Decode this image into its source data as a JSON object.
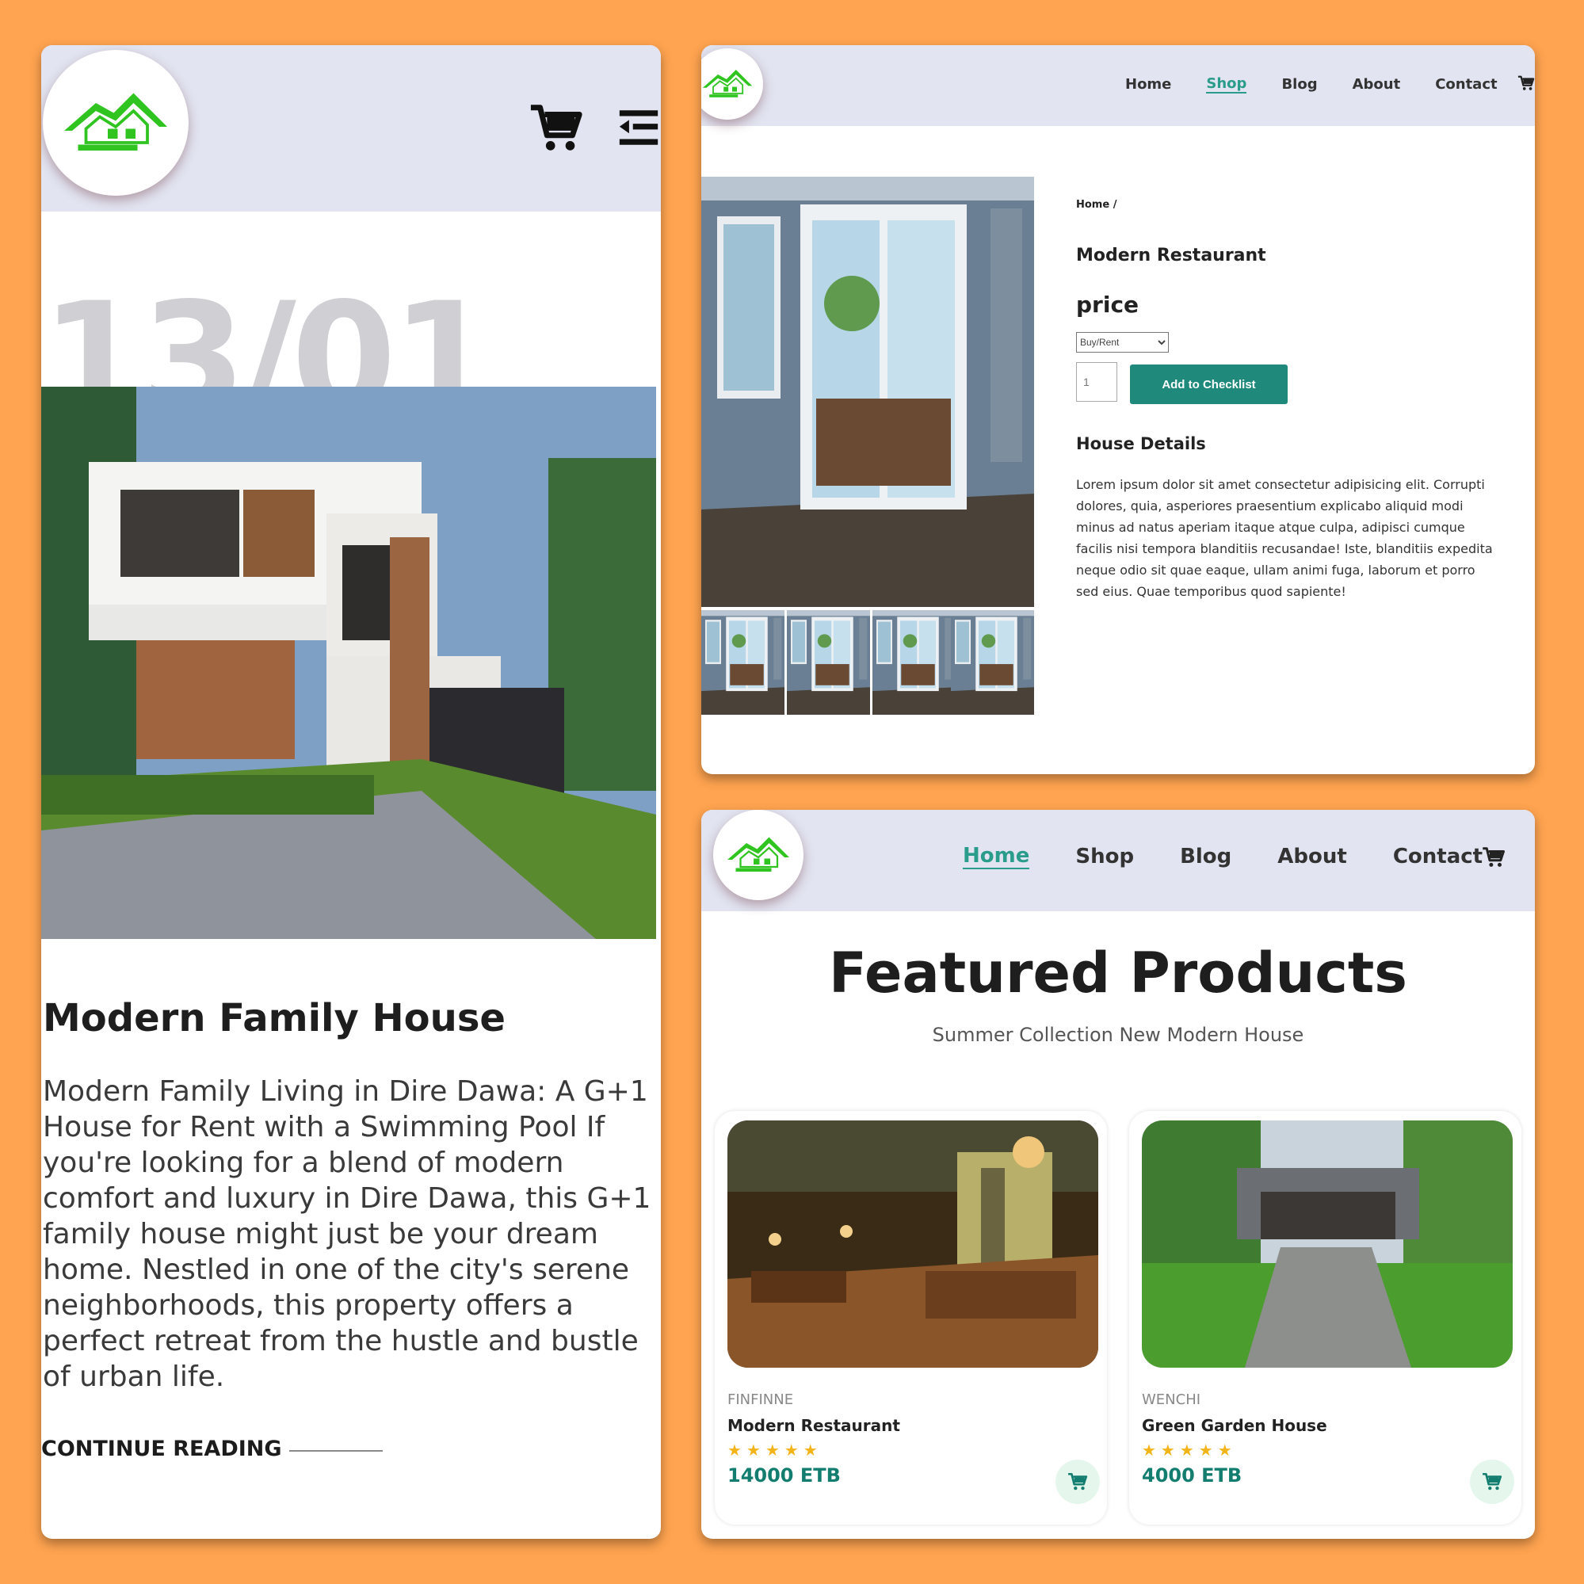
{
  "colors": {
    "background": "#ffa450",
    "nav": "#e2e4f1",
    "accent": "#2a9c8b",
    "price": "#137d70",
    "star": "#f3b419",
    "logo_green": "#2fc41f"
  },
  "card_blog": {
    "date": "13/01",
    "title": "Modern Family House",
    "paragraph": "Modern Family Living in Dire Dawa: A G+1 House for Rent with a Swimming Pool If you're looking for a blend of modern comfort and luxury in Dire Dawa, this G+1 family house might just be your dream home. Nestled in one of the city's serene neighborhoods, this property offers a perfect retreat from the hustle and bustle of urban life.",
    "continue_label": "CONTINUE READING",
    "icons": [
      "logo",
      "cart-icon",
      "menu-icon"
    ]
  },
  "card_detail": {
    "nav": [
      "Home",
      "Shop",
      "Blog",
      "About",
      "Contact"
    ],
    "active_nav": "Shop",
    "breadcrumb": "Home /",
    "product_title": "Modern Restaurant",
    "price_label": "price",
    "select_value": "Buy/Rent",
    "qty_value": "1",
    "add_button": "Add to Checklist",
    "details_heading": "House Details",
    "details_text": "Lorem ipsum dolor sit amet consectetur adipisicing elit. Corrupti dolores, quia, asperiores praesentium explicabo aliquid modi minus ad natus aperiam itaque atque culpa, adipisci cumque facilis nisi tempora blanditiis recusandae! Iste, blanditiis expedita neque odio sit quae eaque, ullam animi fuga, laborum et porro sed eius. Quae temporibus quod sapiente!"
  },
  "card_featured": {
    "nav": [
      "Home",
      "Shop",
      "Blog",
      "About",
      "Contact"
    ],
    "active_nav": "Home",
    "heading": "Featured Products",
    "subheading": "Summer Collection New Modern House",
    "products": [
      {
        "brand": "FINFINNE",
        "name": "Modern Restaurant",
        "stars": "★★★★★",
        "price": "14000 ETB"
      },
      {
        "brand": "WENCHI",
        "name": "Green Garden House",
        "stars": "★★★★★",
        "price": "4000 ETB"
      }
    ]
  }
}
